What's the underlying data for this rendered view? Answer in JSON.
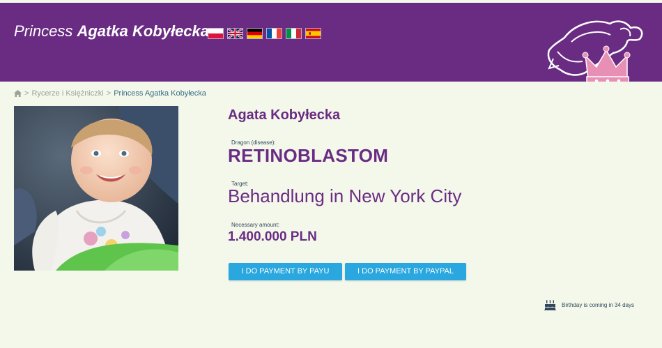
{
  "header": {
    "title_prefix": "Princess",
    "title_name": "Agatka Kobyłecka",
    "flags": [
      {
        "name": "flag-pl",
        "lang": "Polski"
      },
      {
        "name": "flag-gb",
        "lang": "English"
      },
      {
        "name": "flag-de",
        "lang": "Deutsch"
      },
      {
        "name": "flag-fr",
        "lang": "Français"
      },
      {
        "name": "flag-it",
        "lang": "Italiano"
      },
      {
        "name": "flag-es",
        "lang": "Español"
      }
    ]
  },
  "breadcrumb": {
    "home_icon": "home-icon",
    "separator": ">",
    "items": [
      "Rycerze i Księżniczki",
      "Princess Agatka Kobyłecka"
    ]
  },
  "profile": {
    "name": "Agata Kobyłecka",
    "disease_label": "Dragon (disease):",
    "disease_value": "RETINOBLASTOM",
    "target_label": "Target:",
    "target_value": "Behandlung in New York City",
    "amount_label": "Necessary amount:",
    "amount_value": "1.400.000 PLN"
  },
  "buttons": {
    "payu": "I DO PAYMENT BY PAYU",
    "paypal": "I DO PAYMENT BY PAYPAL"
  },
  "birthday": {
    "icon": "birthday-cake-icon",
    "text": "Birthday is coming in 34 days"
  },
  "colors": {
    "header_bg": "#6a2c83",
    "page_bg": "#f3f8eb",
    "accent_purple": "#6a2c83",
    "button_blue": "#29a7de",
    "crown_pink": "#e88fb6"
  }
}
